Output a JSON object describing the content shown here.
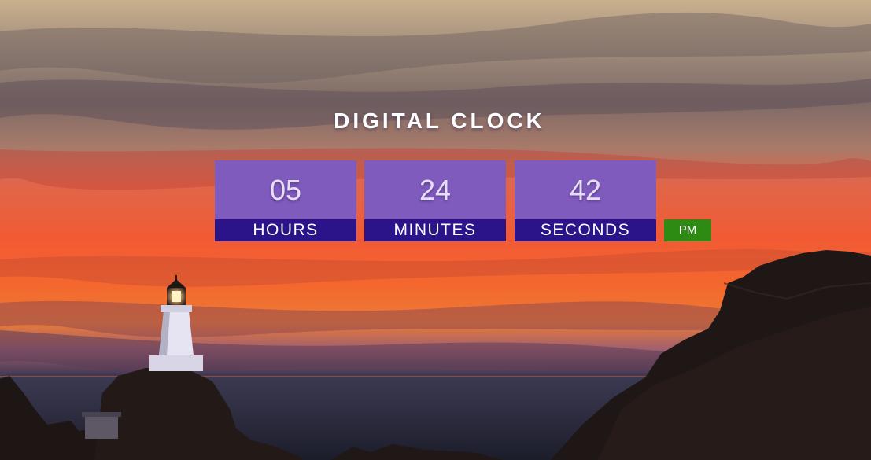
{
  "clock": {
    "title": "DIGITAL CLOCK",
    "units": [
      {
        "value": "05",
        "label": "HOURS"
      },
      {
        "value": "24",
        "label": "MINUTES"
      },
      {
        "value": "42",
        "label": "SECONDS"
      }
    ],
    "period": "PM"
  },
  "colors": {
    "unit_background": "#7f5bbd",
    "label_background": "#2b148a",
    "period_background": "#2d8a13"
  },
  "background": {
    "icon": "sunset-lighthouse-photo"
  }
}
